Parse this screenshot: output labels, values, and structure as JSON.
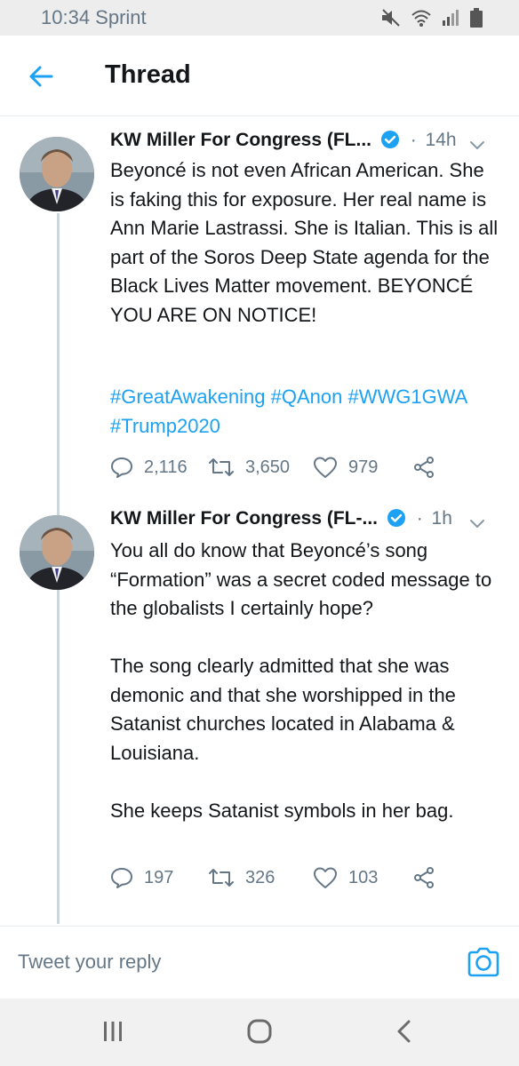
{
  "status_bar": {
    "time_carrier": "10:34 Sprint",
    "icons": [
      "mute-icon",
      "wifi-icon",
      "signal-icon",
      "battery-icon"
    ]
  },
  "header": {
    "back_icon": "arrow-left-icon",
    "title": "Thread"
  },
  "colors": {
    "accent": "#1da1f2",
    "text": "#14171a",
    "secondary": "#657786"
  },
  "tweets": [
    {
      "author": "KW Miller For Congress (FL...",
      "time": "14h",
      "text": "Beyoncé is not even African American. She is faking this for exposure. Her real name is Ann Marie Lastrassi. She is Italian. This is all part of the Soros Deep State agenda for the Black Lives Matter movement. BEYONCÉ YOU ARE ON NOTICE!",
      "hashtags": [
        "#GreatAwakening",
        "#QAnon",
        "#WWG1GWA",
        "#Trump2020"
      ],
      "replies": "2,116",
      "retweets": "3,650",
      "likes": "979"
    },
    {
      "author": "KW Miller For Congress (FL-...",
      "time": "1h",
      "text": "You all do know that Beyoncé’s song “Formation” was a secret coded message to the globalists I certainly hope?\n\nThe song clearly admitted that she was demonic and that she worshipped in the Satanist churches located in Alabama & Louisiana.\n\nShe keeps Satanist symbols in her bag.",
      "replies": "197",
      "retweets": "326",
      "likes": "103"
    }
  ],
  "reply_bar": {
    "placeholder": "Tweet your reply",
    "camera_icon": "camera-icon"
  },
  "nav_bar": {
    "icons": [
      "recent-apps-icon",
      "home-icon",
      "back-icon"
    ]
  }
}
